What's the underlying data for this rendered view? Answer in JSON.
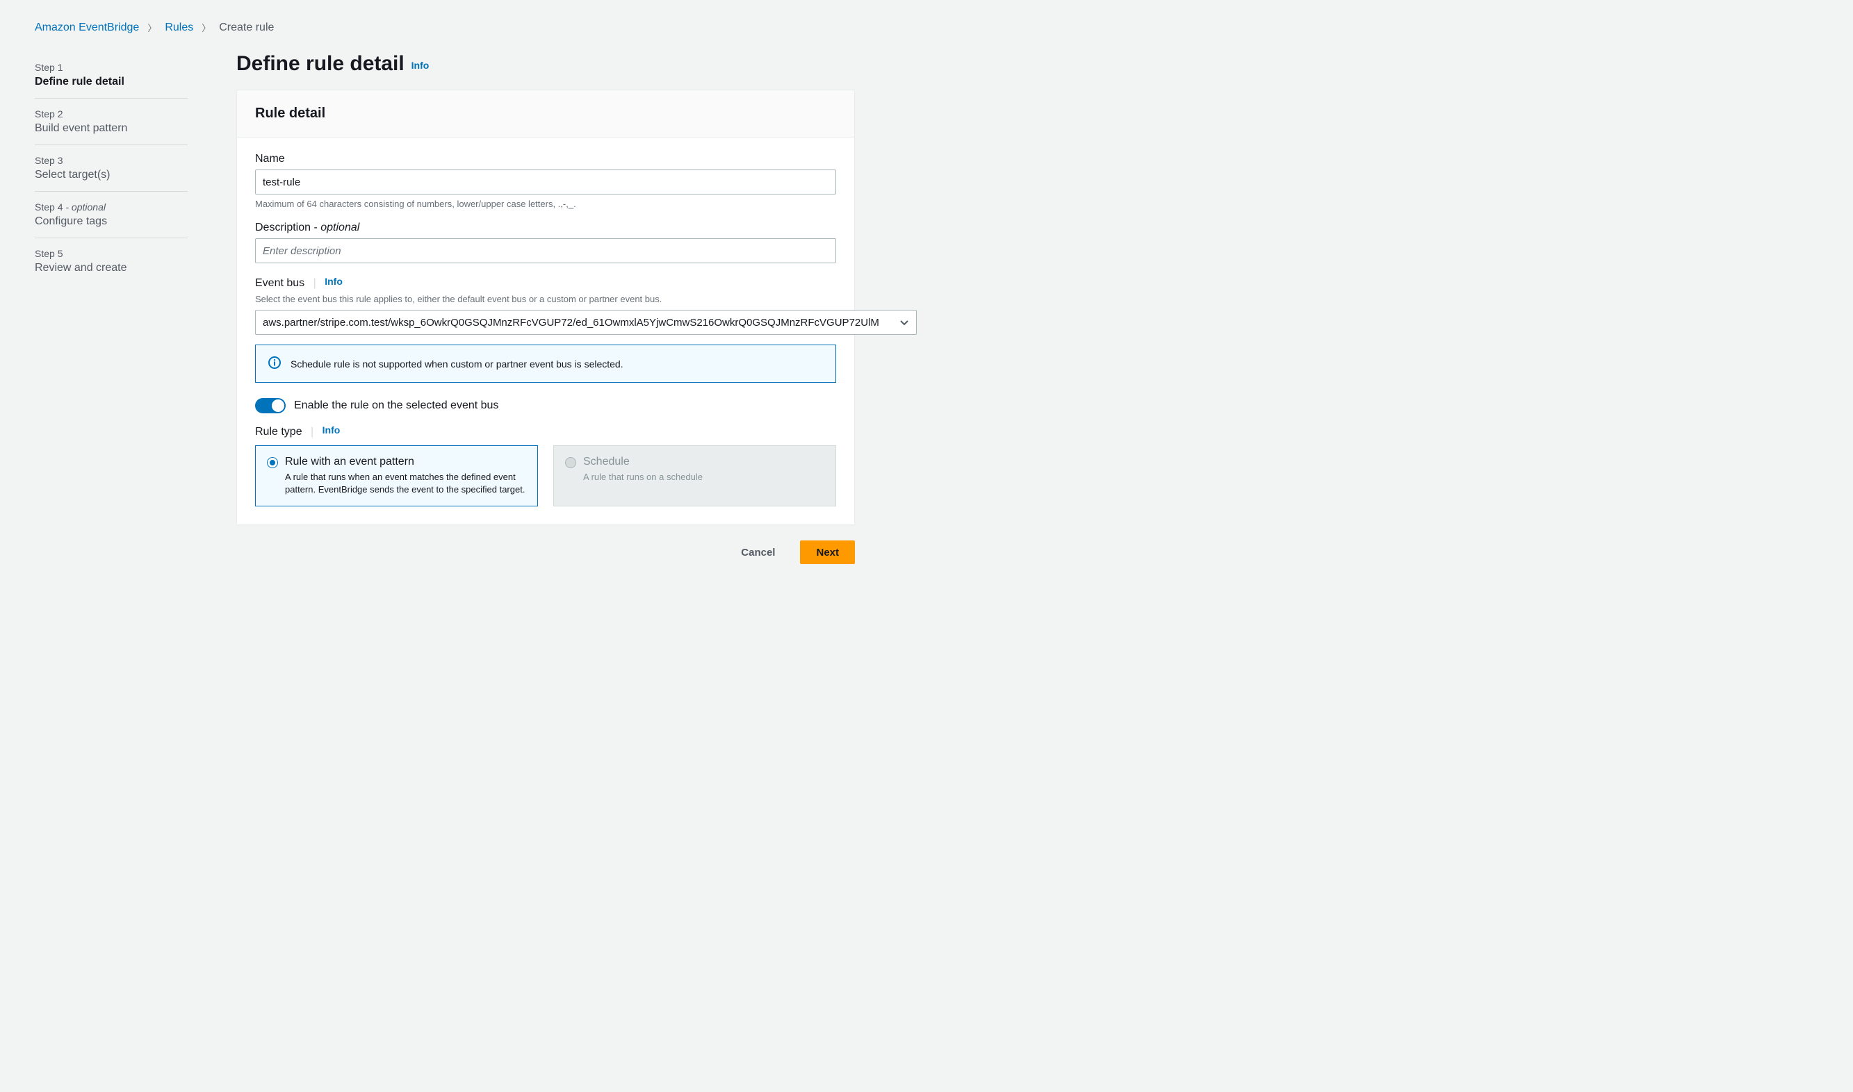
{
  "breadcrumb": {
    "root": "Amazon EventBridge",
    "rules": "Rules",
    "current": "Create rule"
  },
  "wizard": {
    "steps": [
      {
        "num": "Step 1",
        "name": "Define rule detail",
        "active": true
      },
      {
        "num": "Step 2",
        "name": "Build event pattern"
      },
      {
        "num": "Step 3",
        "name": "Select target(s)"
      },
      {
        "num": "Step 4",
        "optional": " - optional",
        "name": "Configure tags"
      },
      {
        "num": "Step 5",
        "name": "Review and create"
      }
    ]
  },
  "page": {
    "title": "Define rule detail",
    "info": "Info"
  },
  "panel": {
    "header": "Rule detail",
    "name_label": "Name",
    "name_value": "test-rule",
    "name_hint": "Maximum of 64 characters consisting of numbers, lower/upper case letters, .,-,_.",
    "desc_label": "Description - ",
    "desc_optional": "optional",
    "desc_placeholder": "Enter description",
    "desc_value": "",
    "bus_label": "Event bus",
    "bus_info": "Info",
    "bus_hint": "Select the event bus this rule applies to, either the default event bus or a custom or partner event bus.",
    "bus_value": "aws.partner/stripe.com.test/wksp_6OwkrQ0GSQJMnzRFcVGUP72/ed_61OwmxlA5YjwCmwS216OwkrQ0GSQJMnzRFcVGUP72UlM",
    "alert_text": "Schedule rule is not supported when custom or partner event bus is selected.",
    "toggle_label": "Enable the rule on the selected event bus",
    "toggle_on": true,
    "ruletype_label": "Rule type",
    "ruletype_info": "Info",
    "option_pattern_title": "Rule with an event pattern",
    "option_pattern_desc": "A rule that runs when an event matches the defined event pattern. EventBridge sends the event to the specified target.",
    "option_schedule_title": "Schedule",
    "option_schedule_desc": "A rule that runs on a schedule"
  },
  "footer": {
    "cancel": "Cancel",
    "next": "Next"
  }
}
